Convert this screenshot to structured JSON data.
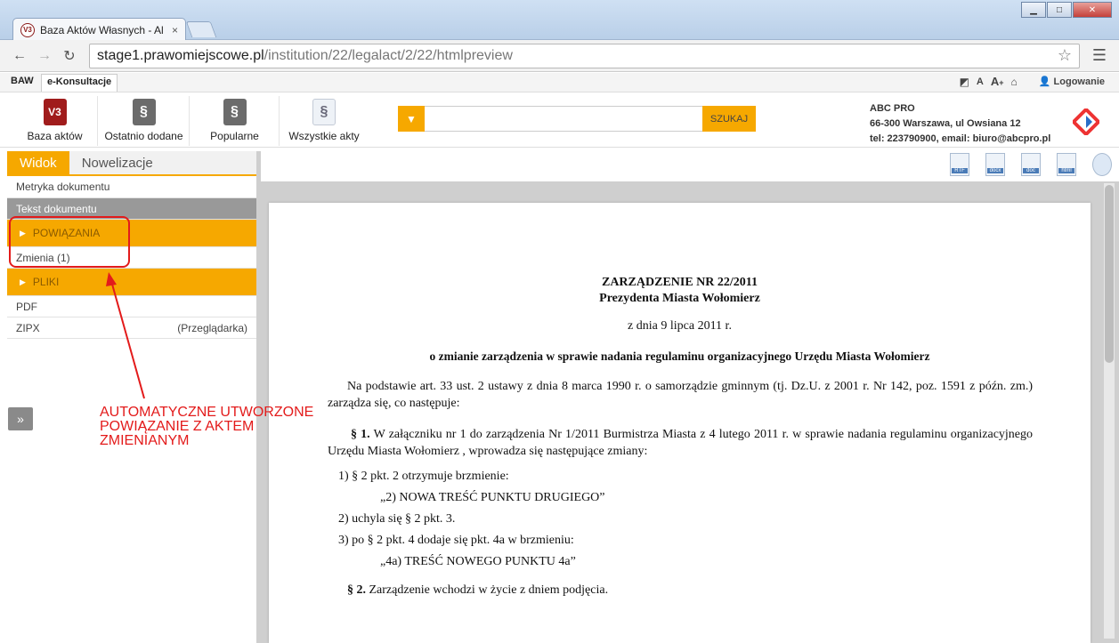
{
  "browser": {
    "tab_title": "Baza Aktów Własnych - Al",
    "tab_close": "×",
    "url_host": "stage1.prawomiejscowe.pl",
    "url_path": "/institution/22/legalact/2/22/htmlpreview"
  },
  "app_tabs": [
    "BAW",
    "e-Konsultacje"
  ],
  "top_tools": {
    "font_small": "A",
    "font_large": "A",
    "font_plus": "+",
    "login": "Logowanie"
  },
  "header": {
    "buttons": [
      {
        "label": "Baza aktów",
        "icon": "baza-icon"
      },
      {
        "label": "Ostatnio dodane",
        "icon": "recent-icon"
      },
      {
        "label": "Popularne",
        "icon": "popular-icon"
      },
      {
        "label": "Wszystkie akty",
        "icon": "all-acts-icon"
      }
    ],
    "search_placeholder": "",
    "search_button": "SZUKAJ",
    "company_name": "ABC PRO",
    "company_address": "66-300 Warszawa, ul Owsiana 12",
    "company_contact": "tel: 223790900, email: biuro@abcpro.pl"
  },
  "sidebar": {
    "tab_active": "Widok",
    "tab_inactive": "Nowelizacje",
    "metryka": "Metryka dokumentu",
    "tekst": "Tekst dokumentu",
    "powiazania": "POWIĄZANIA",
    "zmienia": "Zmienia (1)",
    "pliki": "PLIKI",
    "pdf": "PDF",
    "zipx": "ZIPX",
    "przegladarka": "(Przeglądarka)",
    "expand": "»"
  },
  "annotation": {
    "line1": "AUTOMATYCZNE UTWORZONE",
    "line2": "POWIĄZANIE Z AKTEM",
    "line3": "ZMIENIANYM"
  },
  "exports": [
    "RTF",
    "docx",
    "doc",
    "html",
    "print"
  ],
  "document": {
    "title1": "ZARZĄDZENIE NR 22/2011",
    "title2": "Prezydenta Miasta Wołomierz",
    "date": "z dnia 9 lipca 2011 r.",
    "subject": "o zmianie zarządzenia w sprawie nadania regulaminu organizacyjnego Urzędu Miasta Wołomierz",
    "preamble": "Na podstawie art. 33 ust. 2 ustawy z dnia 8 marca 1990 r. o samorządzie gminnym (tj. Dz.U. z 2001 r. Nr 142, poz. 1591 z późn. zm.) zarządza się, co następuje:",
    "par1_label": "§ 1.",
    "par1_text": "W załączniku nr 1 do zarządzenia Nr 1/2011 Burmistrza Miasta z 4 lutego 2011 r. w sprawie nadania regulaminu organizacyjnego Urzędu Miasta Wołomierz , wprowadza się następujące zmiany:",
    "item1": "1) § 2 pkt. 2 otrzymuje brzmienie:",
    "item1_quote": "„2)  NOWA TREŚĆ PUNKTU DRUGIEGO”",
    "item2": "2) uchyla się § 2 pkt. 3.",
    "item3": "3) po § 2 pkt. 4 dodaje się pkt. 4a w brzmieniu:",
    "item3_quote": "„4a) TREŚĆ NOWEGO PUNKTU 4a”",
    "par2_label": "§ 2.",
    "par2_text": "Zarządzenie wchodzi w życie z dniem podjęcia."
  },
  "colors": {
    "accent": "#f6a800",
    "annotation": "#e31b1b"
  }
}
